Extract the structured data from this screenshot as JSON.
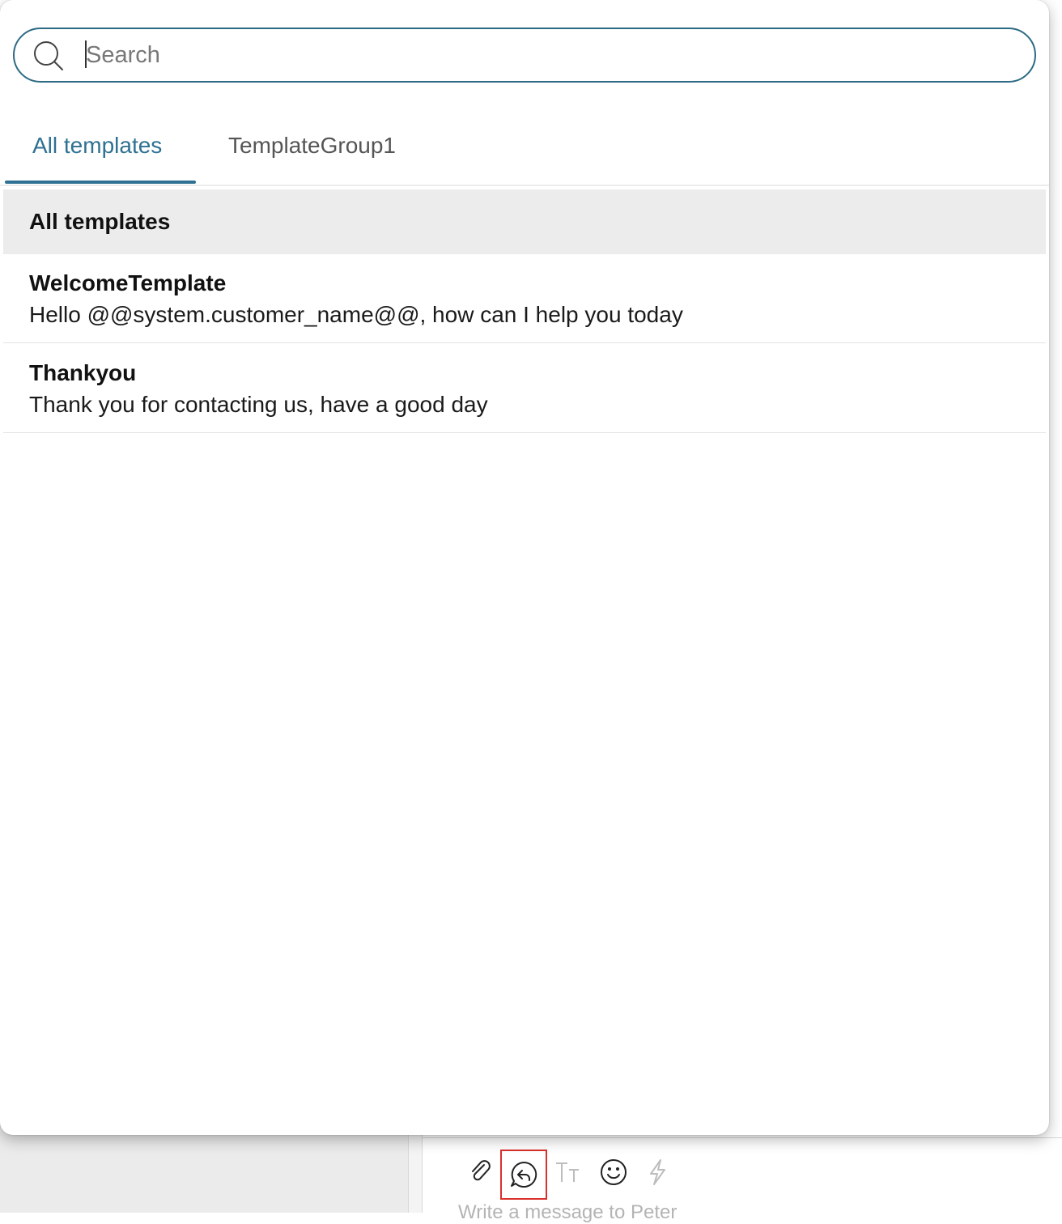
{
  "search": {
    "placeholder": "Search",
    "value": ""
  },
  "tabs": [
    {
      "label": "All templates",
      "active": true
    },
    {
      "label": "TemplateGroup1",
      "active": false
    }
  ],
  "group_header": "All templates",
  "templates": [
    {
      "name": "WelcomeTemplate",
      "body": "Hello @@system.customer_name@@, how can I help you today"
    },
    {
      "name": "Thankyou",
      "body": "Thank you for contacting us, have a good day"
    }
  ],
  "composer": {
    "toolbar": [
      {
        "icon": "paperclip-icon",
        "state": "enabled"
      },
      {
        "icon": "template-reply-icon",
        "state": "selected"
      },
      {
        "icon": "text-format-icon",
        "state": "disabled"
      },
      {
        "icon": "emoji-icon",
        "state": "enabled"
      },
      {
        "icon": "lightning-icon",
        "state": "disabled"
      }
    ],
    "placeholder": "Write a message to Peter"
  },
  "colors": {
    "accent": "#2e7192",
    "search_border": "#2d6a84",
    "group_header_bg": "#ececec",
    "highlight_box": "#d9302b"
  }
}
